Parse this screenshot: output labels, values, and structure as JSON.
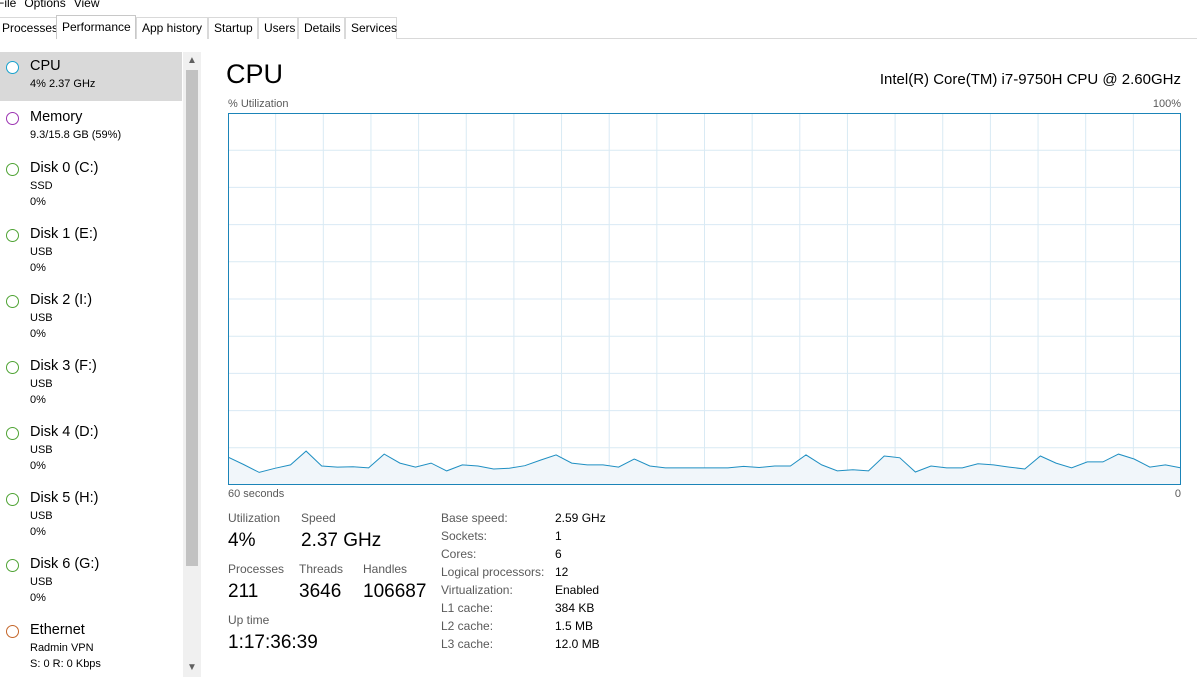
{
  "menu": [
    "File",
    "Options",
    "View"
  ],
  "tabs": [
    "Processes",
    "Performance",
    "App history",
    "Startup",
    "Users",
    "Details",
    "Services"
  ],
  "active_tab": "Performance",
  "sidebar": [
    {
      "title": "CPU",
      "lines": [
        "4%  2.37 GHz"
      ],
      "color": "#17a2ce",
      "selected": true
    },
    {
      "title": "Memory",
      "lines": [
        "9.3/15.8 GB (59%)"
      ],
      "color": "#9c34b2"
    },
    {
      "title": "Disk 0 (C:)",
      "lines": [
        "SSD",
        "0%"
      ],
      "color": "#4fa334"
    },
    {
      "title": "Disk 1 (E:)",
      "lines": [
        "USB",
        "0%"
      ],
      "color": "#4fa334"
    },
    {
      "title": "Disk 2 (I:)",
      "lines": [
        "USB",
        "0%"
      ],
      "color": "#4fa334"
    },
    {
      "title": "Disk 3 (F:)",
      "lines": [
        "USB",
        "0%"
      ],
      "color": "#4fa334"
    },
    {
      "title": "Disk 4 (D:)",
      "lines": [
        "USB",
        "0%"
      ],
      "color": "#4fa334"
    },
    {
      "title": "Disk 5 (H:)",
      "lines": [
        "USB",
        "0%"
      ],
      "color": "#4fa334"
    },
    {
      "title": "Disk 6 (G:)",
      "lines": [
        "USB",
        "0%"
      ],
      "color": "#4fa334"
    },
    {
      "title": "Ethernet",
      "lines": [
        "Radmin VPN",
        "S: 0  R: 0 Kbps"
      ],
      "color": "#c4662a"
    }
  ],
  "header": {
    "title": "CPU",
    "model": "Intel(R) Core(TM) i7-9750H CPU @ 2.60GHz",
    "util_label": "% Utilization",
    "util_max": "100%",
    "time_left": "60 seconds",
    "time_right": "0"
  },
  "stats": {
    "utilization_label": "Utilization",
    "utilization": "4%",
    "speed_label": "Speed",
    "speed": "2.37 GHz",
    "processes_label": "Processes",
    "processes": "211",
    "threads_label": "Threads",
    "threads": "3646",
    "handles_label": "Handles",
    "handles": "106687",
    "uptime_label": "Up time",
    "uptime": "1:17:36:39"
  },
  "specs": [
    {
      "key": "Base speed:",
      "value": "2.59 GHz"
    },
    {
      "key": "Sockets:",
      "value": "1"
    },
    {
      "key": "Cores:",
      "value": "6"
    },
    {
      "key": "Logical processors:",
      "value": "12"
    },
    {
      "key": "Virtualization:",
      "value": "Enabled"
    },
    {
      "key": "L1 cache:",
      "value": "384 KB"
    },
    {
      "key": "L2 cache:",
      "value": "1.5 MB"
    },
    {
      "key": "L3 cache:",
      "value": "12.0 MB"
    }
  ],
  "chart_data": {
    "type": "area",
    "ylim": [
      0,
      100
    ],
    "values": [
      7.5,
      5.5,
      3.4,
      4.5,
      5.4,
      9.1,
      5.1,
      4.8,
      4.9,
      4.6,
      8.3,
      5.9,
      4.8,
      5.9,
      3.8,
      5.4,
      5.1,
      4.3,
      4.5,
      5.2,
      6.7,
      8.1,
      5.9,
      5.4,
      5.4,
      4.8,
      7.0,
      5.1,
      4.6,
      4.6,
      4.6,
      4.6,
      4.6,
      5.0,
      4.7,
      5.1,
      5.1,
      8.1,
      5.4,
      3.8,
      4.1,
      3.8,
      7.8,
      7.3,
      3.5,
      5.1,
      4.6,
      4.6,
      5.7,
      5.4,
      4.8,
      4.3,
      7.8,
      5.9,
      4.6,
      6.2,
      6.2,
      8.3,
      7.0,
      4.8,
      5.4,
      4.6
    ],
    "line_color": "#1f8fc2",
    "fill_color": "#f1f6fa",
    "grid_color": "#d9eaf4"
  }
}
